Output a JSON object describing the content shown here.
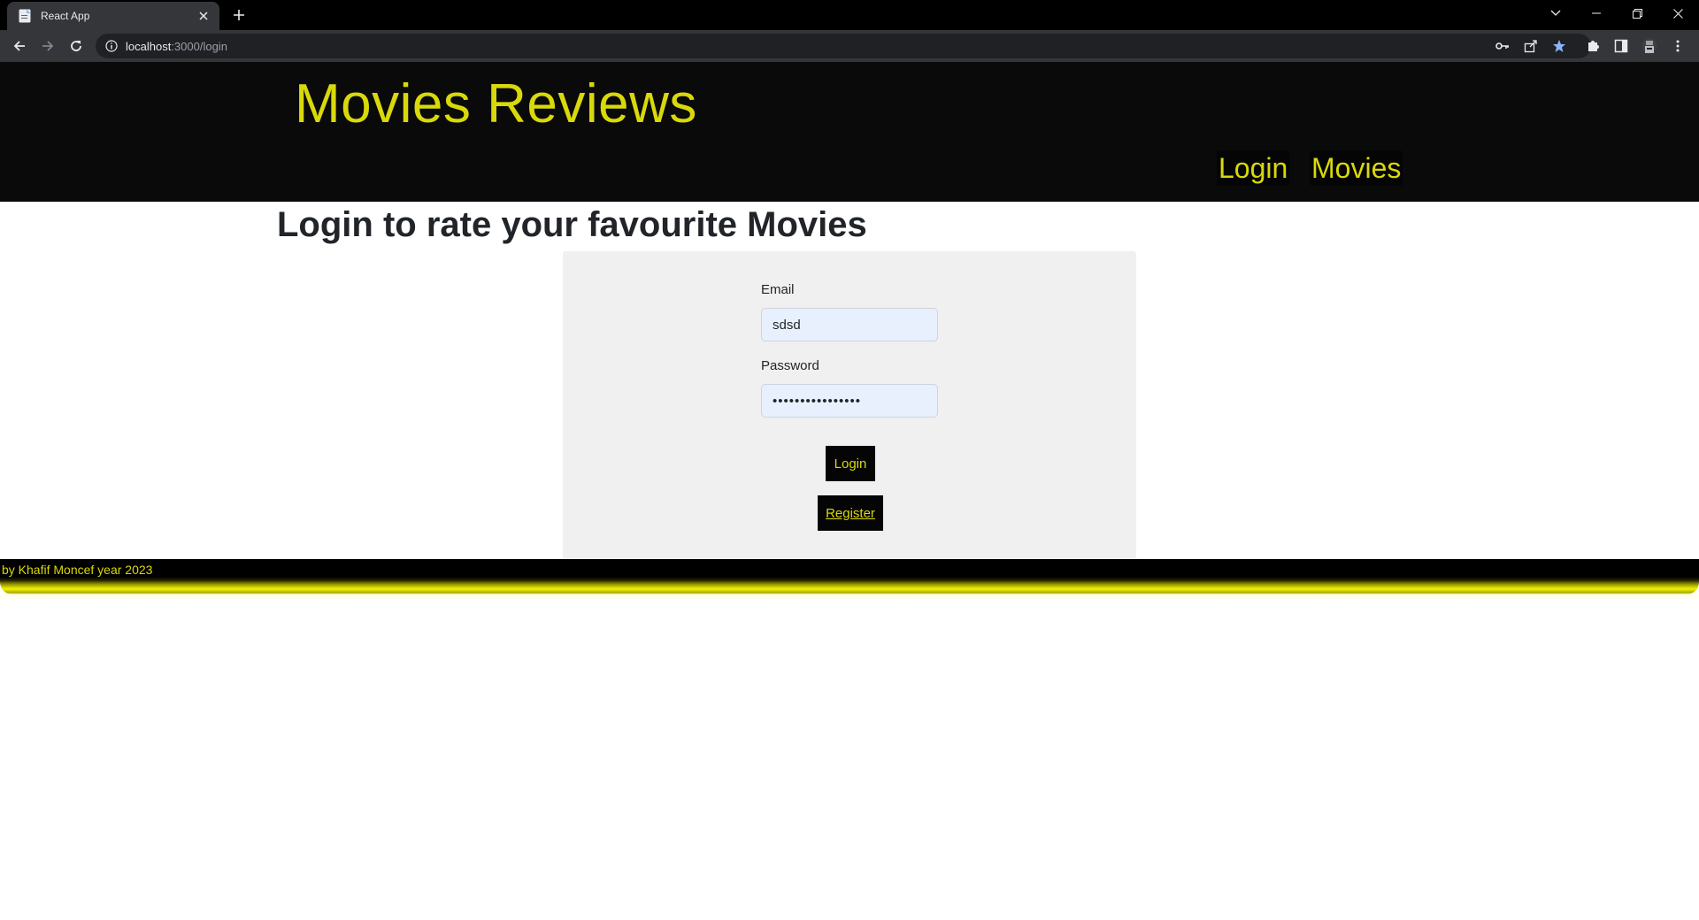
{
  "browser": {
    "tab_title": "React App",
    "url_host": "localhost",
    "url_path": ":3000/login"
  },
  "site": {
    "brand": "Movies Reviews",
    "nav": [
      {
        "label": "Login"
      },
      {
        "label": "Movies"
      }
    ],
    "accent_color": "#d9d90a"
  },
  "main": {
    "heading": "Login to rate your favourite Movies"
  },
  "form": {
    "email_label": "Email",
    "email_value": "sdsd",
    "password_label": "Password",
    "password_value": "••••••••••••••••",
    "login_button": "Login",
    "register_button": "Register"
  },
  "footer": {
    "text": "by Khafif Moncef year 2023"
  }
}
